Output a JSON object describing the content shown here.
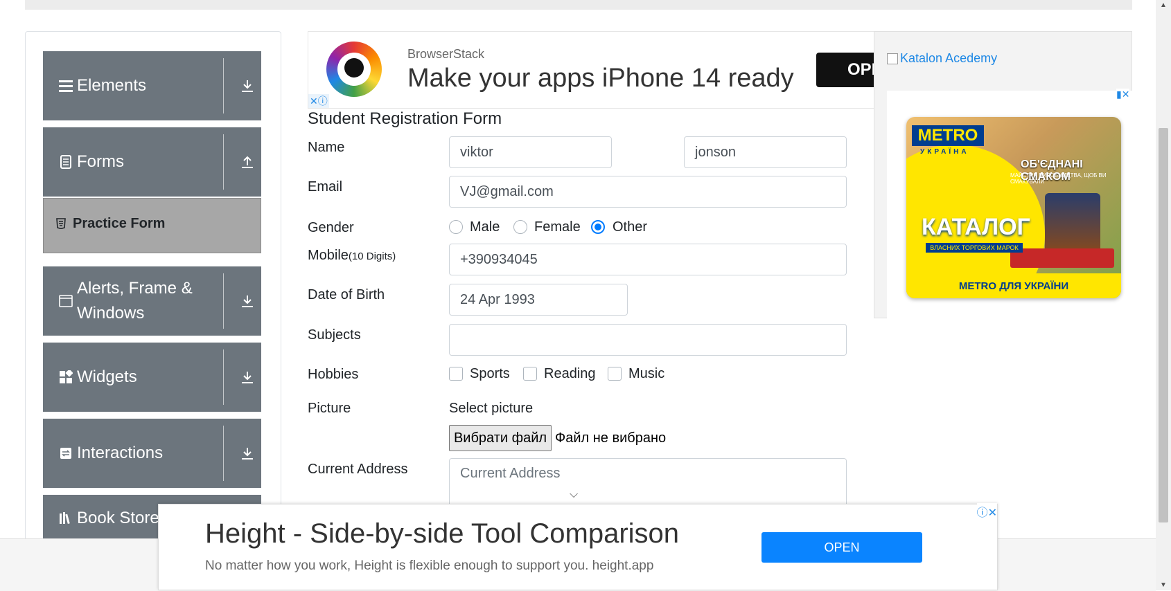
{
  "sidebar": {
    "groups": [
      {
        "label": "Elements",
        "icon": "hamburger-icon",
        "arrow": "download-icon"
      },
      {
        "label": "Forms",
        "icon": "document-icon",
        "arrow": "upload-icon"
      },
      {
        "label": "Alerts, Frame & Windows",
        "icon": "window-icon",
        "arrow": "download-icon"
      },
      {
        "label": "Widgets",
        "icon": "widgets-icon",
        "arrow": "download-icon"
      },
      {
        "label": "Interactions",
        "icon": "interactions-icon",
        "arrow": "download-icon"
      },
      {
        "label": "Book Store",
        "icon": "books-icon",
        "arrow": "download-icon"
      }
    ],
    "active_item": "Practice Form"
  },
  "ads": {
    "top": {
      "brand": "BrowserStack",
      "headline": "Make your apps iPhone 14 ready",
      "button": "OPEN"
    },
    "right": {
      "alt": "Katalon Acedemy",
      "metro": {
        "logo": "METRO",
        "sub": "УКРАЇНА",
        "tagline": "ОБ'ЄДНАНІ СМАКОМ",
        "tagline2": "МАЙСТРИ ВИРОБНИЦТВА, ЩОБ ВИ СМАКУВАЛИ",
        "catalog": "КАТАЛОГ",
        "band": "ВЛАСНИХ ТОРГОВИХ МАРОК",
        "footer": "METRO ДЛЯ УКРАЇНИ"
      }
    },
    "bottom": {
      "headline": "Height - Side-by-side Tool Comparison",
      "sub": "No matter how you work, Height is flexible enough to support you. height.app",
      "button": "OPEN"
    }
  },
  "form": {
    "title": "Student Registration Form",
    "labels": {
      "name": "Name",
      "email": "Email",
      "gender": "Gender",
      "mobile": "Mobile",
      "mobile_hint": "(10 Digits)",
      "dob": "Date of Birth",
      "subjects": "Subjects",
      "hobbies": "Hobbies",
      "picture": "Picture",
      "address": "Current Address"
    },
    "first_name": "viktor",
    "last_name": "jonson",
    "email": "VJ@gmail.com",
    "gender_options": [
      "Male",
      "Female",
      "Other"
    ],
    "gender_selected": "Other",
    "mobile": "+390934045",
    "dob": "24 Apr 1993",
    "subjects": "",
    "hobbies": [
      "Sports",
      "Reading",
      "Music"
    ],
    "picture_label": "Select picture",
    "file_button": "Вибрати файл",
    "file_status": "Файл не вибрано",
    "address_placeholder": "Current Address"
  }
}
